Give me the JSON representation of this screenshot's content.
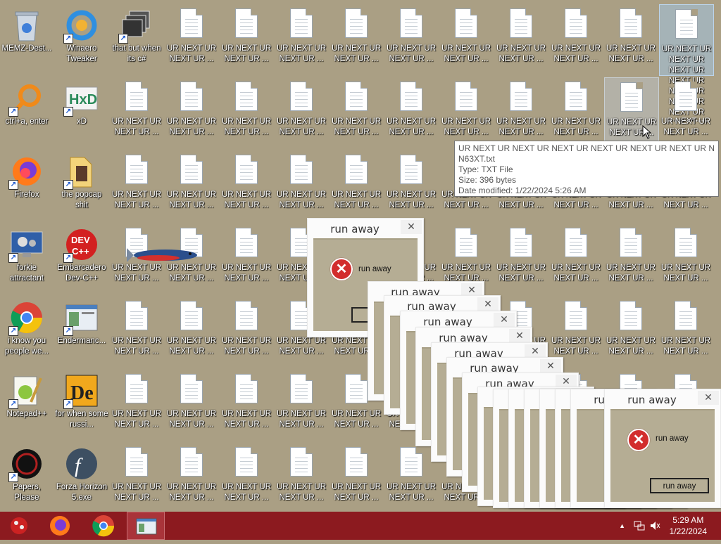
{
  "desktop": {
    "icons": [
      {
        "label": "MEMZ-Dest...",
        "icon": "recycle-bin-icon"
      },
      {
        "label": "Winaero Tweaker",
        "icon": "winaero-icon"
      },
      {
        "label": "that but when its c#",
        "icon": "windows-stack-icon"
      },
      {
        "label": "ctrl+a, enter",
        "icon": "magnifier-icon"
      },
      {
        "label": "xD",
        "icon": "hxd-icon"
      },
      {
        "label": "Firefox",
        "icon": "firefox-icon"
      },
      {
        "label": "the popcap shit",
        "icon": "popcap-folder-icon"
      },
      {
        "label": "forkie attractant",
        "icon": "monitor-gear-icon"
      },
      {
        "label": "Embarcadero Dev-C++",
        "icon": "devcpp-icon"
      },
      {
        "label": "i know you people we...",
        "icon": "chrome-icon"
      },
      {
        "label": "Endermanc...",
        "icon": "window-app-icon"
      },
      {
        "label": "Notepad++",
        "icon": "notepad-plus-icon"
      },
      {
        "label": "for when some russi...",
        "icon": "die-icon"
      },
      {
        "label": "Papers, Please",
        "icon": "papers-please-icon"
      },
      {
        "label": "Forza Horizon 5.exe",
        "icon": "flash-icon"
      }
    ],
    "file_label": "UR NEXT UR NEXT UR ...",
    "selected_file_label": "UR NEXT UR NEXT UR NEXT UR NEXT UR NEXT UR NEXT UR NEXT UR N63XT.txt"
  },
  "tooltip": {
    "line1": "UR NEXT UR NEXT UR NEXT UR NEXT UR NEXT UR NEXT UR NEXT UR",
    "line2": "N63XT.txt",
    "line3": "Type: TXT File",
    "line4": "Size: 396 bytes",
    "line5": "Date modified: 1/22/2024 5:26 AM"
  },
  "dialogs": {
    "title": "run away",
    "message": "run away",
    "button": "run away",
    "close": "✕"
  },
  "taskbar": {
    "time": "5:29 AM",
    "date": "1/22/2024",
    "tray_up": "▲",
    "apps": [
      "memz-icon",
      "firefox-icon",
      "chrome-icon",
      "window-app-icon"
    ]
  },
  "colors": {
    "desktop": "#aa9f84",
    "taskbar": "#8c1a1f",
    "error": "#d22d2d"
  }
}
